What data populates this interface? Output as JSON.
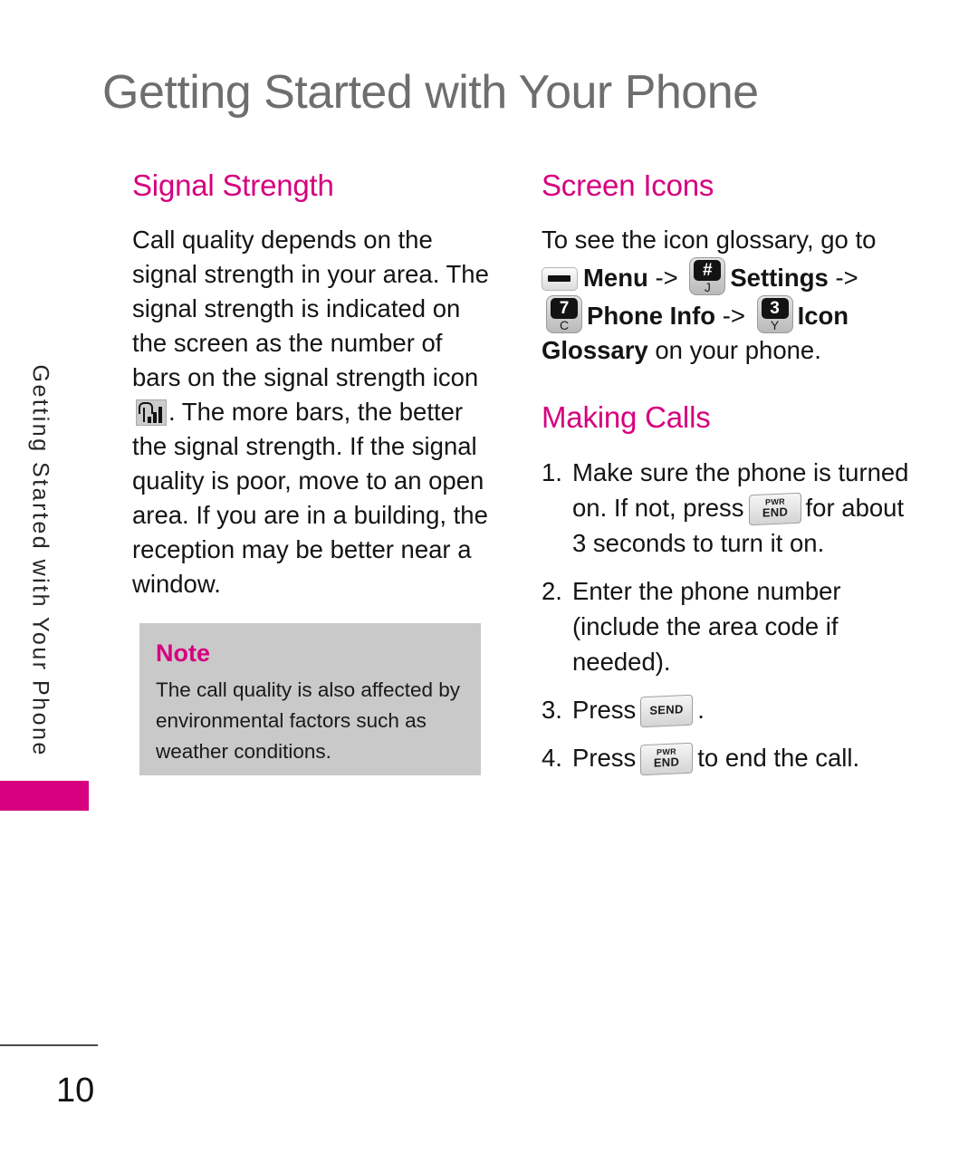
{
  "page": {
    "title": "Getting Started with Your Phone",
    "side_tab_label": "Getting Started with Your Phone",
    "page_number": "10"
  },
  "left_column": {
    "heading": "Signal Strength",
    "paragraph_part1": "Call quality depends on the signal strength in your area. The signal strength is indicated on the screen as the number of bars on the signal strength icon",
    "paragraph_part2": ". The more bars, the better the signal strength. If the signal quality is poor, move to an open area. If you are in a building, the reception may be better near a window.",
    "signal_icon_name": "signal-strength-icon",
    "note": {
      "title": "Note",
      "body": "The call quality is also affected by environmental factors such as weather conditions."
    }
  },
  "right_column": {
    "screen_icons": {
      "heading": "Screen Icons",
      "intro": "To see the icon glossary, go to",
      "path_line1_menu": "Menu",
      "path_arrow1": "->",
      "path_line1_settings": "Settings",
      "path_arrow2": "->",
      "path_line2_phone_info": "Phone Info",
      "path_arrow3": "->",
      "path_line2_icon": "Icon",
      "path_line3_bold": "Glossary",
      "path_line3_rest": " on your phone."
    },
    "making_calls": {
      "heading": "Making Calls",
      "steps": [
        {
          "number": "1.",
          "text_before": "Make sure the phone is turned on. If not, press",
          "key": "pwr-end",
          "text_after": "for about 3 seconds to turn it on."
        },
        {
          "number": "2.",
          "text_before": "Enter the phone number (include the area code if needed).",
          "key": "",
          "text_after": ""
        },
        {
          "number": "3.",
          "text_before": "Press",
          "key": "send",
          "text_after": "."
        },
        {
          "number": "4.",
          "text_before": "Press",
          "key": "pwr-end",
          "text_after": "to end the call."
        }
      ]
    }
  },
  "keys": {
    "softkey_left": {
      "name": "soft-key-icon",
      "label": ""
    },
    "hash_j": {
      "name": "key-hash-j-icon",
      "top": "#",
      "bottom": "J"
    },
    "seven_c": {
      "name": "key-7-c-icon",
      "top": "7",
      "bottom": "C"
    },
    "three_y": {
      "name": "key-3-y-icon",
      "top": "3",
      "bottom": "Y"
    },
    "pwr_end": {
      "name": "pwr-end-key-icon",
      "line1": "PWR",
      "line2": "END"
    },
    "send": {
      "name": "send-key-icon",
      "line1": "",
      "line2": "SEND"
    }
  },
  "colors": {
    "accent_magenta": "#d6007f",
    "title_gray": "#6e6e6e",
    "note_bg": "#c9c9c9",
    "body_text": "#141414"
  }
}
